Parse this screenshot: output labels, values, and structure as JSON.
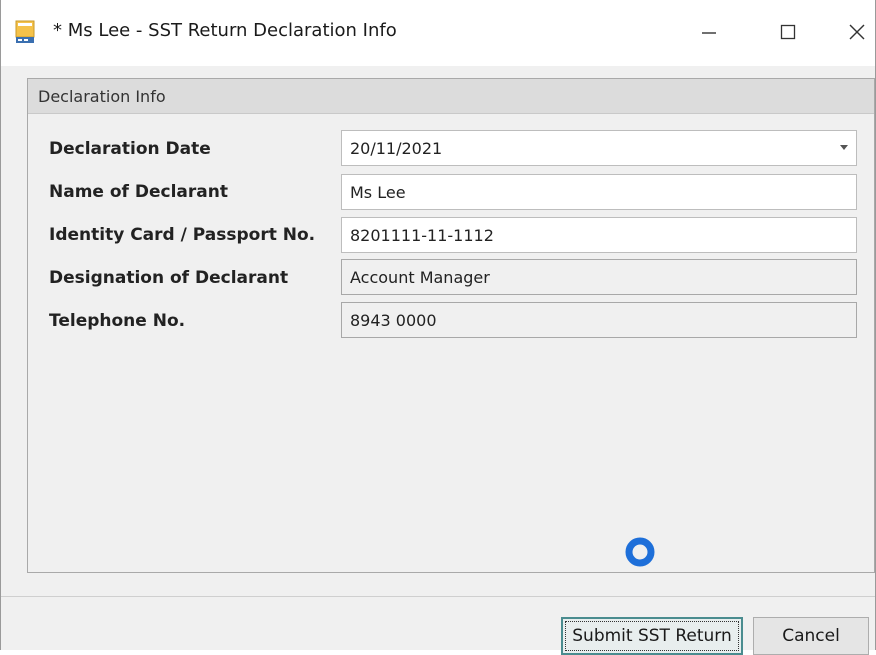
{
  "window": {
    "title": "* Ms Lee - SST Return Declaration Info",
    "icon": "app-document-icon"
  },
  "panel": {
    "header": "Declaration Info"
  },
  "form": {
    "declaration_date": {
      "label": "Declaration Date",
      "value": "20/11/2021"
    },
    "name_of_declarant": {
      "label": "Name of Declarant",
      "value": "Ms Lee"
    },
    "identity_card": {
      "label": "Identity Card / Passport No.",
      "value": "8201111-11-1112"
    },
    "designation": {
      "label": "Designation of Declarant",
      "value": "Account Manager"
    },
    "telephone": {
      "label": "Telephone No.",
      "value": "8943 0000"
    }
  },
  "buttons": {
    "submit_label": "Submit SST Return",
    "cancel_label": "Cancel"
  },
  "colors": {
    "accent": "#1e6fd9",
    "submit_border": "#4a8c8f"
  }
}
